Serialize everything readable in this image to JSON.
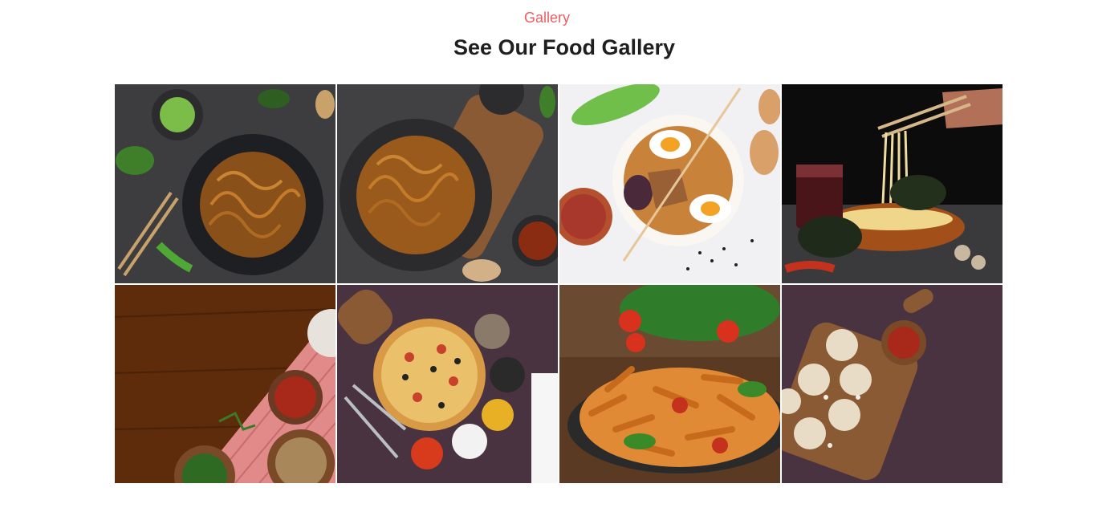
{
  "section": {
    "eyebrow": "Gallery",
    "title": "See Our Food Gallery"
  },
  "gallery": {
    "items": [
      {
        "image": "noodles-in-dark-bowl-photo",
        "palette": {
          "bg": "#3d3d3f",
          "food": "#9a5a1c",
          "accent": "#6fb43c"
        }
      },
      {
        "image": "noodles-in-pan-photo",
        "palette": {
          "bg": "#414143",
          "food": "#a2601f",
          "accent": "#7f5234"
        }
      },
      {
        "image": "ramen-bowl-with-egg-photo",
        "palette": {
          "bg": "#f1f1f3",
          "food": "#d58a3a",
          "accent": "#b23b2b"
        }
      },
      {
        "image": "chopsticks-lifting-noodles-photo",
        "palette": {
          "bg": "#0c0c0c",
          "food": "#e6d08d",
          "accent": "#b5461f"
        }
      },
      {
        "image": "spices-on-wooden-table-photo",
        "palette": {
          "bg": "#5e2b0b",
          "food": "#e18181",
          "accent": "#a8382b"
        }
      },
      {
        "image": "pizza-with-spices-photo",
        "palette": {
          "bg": "#4a3340",
          "food": "#eac06a",
          "accent": "#c7412d"
        }
      },
      {
        "image": "penne-pasta-plate-photo",
        "palette": {
          "bg": "#5a3a22",
          "food": "#e08a35",
          "accent": "#2f7d2a"
        }
      },
      {
        "image": "dumplings-on-board-photo",
        "palette": {
          "bg": "#4a3340",
          "food": "#e9dcc7",
          "accent": "#8a5a35"
        }
      }
    ]
  }
}
